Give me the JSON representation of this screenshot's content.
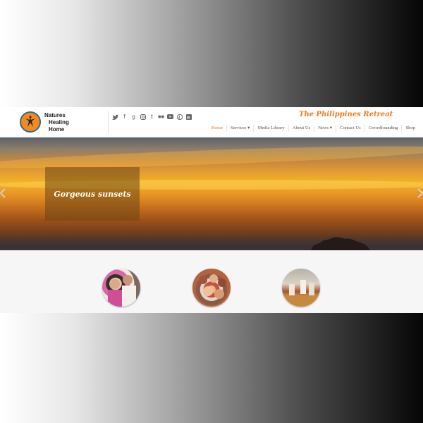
{
  "brand": {
    "name_line1": "Natures",
    "name_line2": "Healing",
    "name_line3": "Home",
    "tagline": "The Philippines Retreat",
    "logo_icon": "yoga-pose-logo-icon",
    "accent_color": "#f07d1a"
  },
  "social_icons": [
    "twitter-icon",
    "facebook-icon",
    "google-plus-icon",
    "instagram-icon",
    "tumblr-icon",
    "flickr-icon",
    "youtube-icon",
    "pinterest-icon",
    "linkedin-icon"
  ],
  "nav": {
    "items": [
      {
        "label": "Home",
        "active": true
      },
      {
        "label": "Services ▾"
      },
      {
        "label": "Media Library"
      },
      {
        "label": "About Us"
      },
      {
        "label": "News ▾"
      },
      {
        "label": "Contact Us"
      },
      {
        "label": "Crowdfounding"
      },
      {
        "label": "Shop"
      }
    ]
  },
  "hero": {
    "caption": "Gorgeous sunsets",
    "prev_icon": "chevron-left-icon",
    "next_icon": "chevron-right-icon"
  },
  "thumbnails": [
    {
      "icon": "children-photo"
    },
    {
      "icon": "group-photo"
    },
    {
      "icon": "event-photo"
    }
  ]
}
